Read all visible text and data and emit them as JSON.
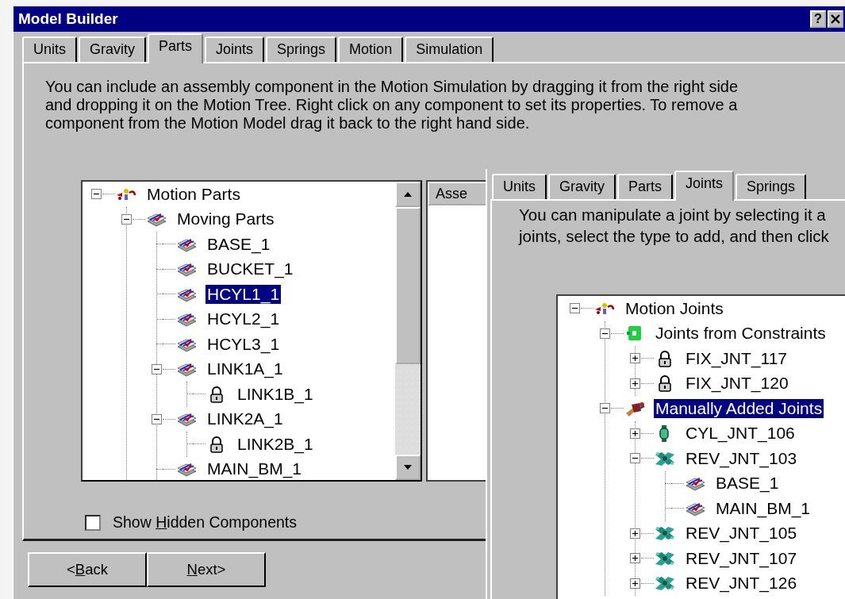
{
  "window": {
    "title": "Model Builder",
    "help_button": "?"
  },
  "tabs": [
    {
      "label": "Units",
      "selected": false
    },
    {
      "label": "Gravity",
      "selected": false
    },
    {
      "label": "Parts",
      "selected": true
    },
    {
      "label": "Joints",
      "selected": false
    },
    {
      "label": "Springs",
      "selected": false
    },
    {
      "label": "Motion",
      "selected": false
    },
    {
      "label": "Simulation",
      "selected": false
    }
  ],
  "description": "You can include an assembly component in the Motion Simulation by dragging it from the right side and dropping it on the Motion Tree. Right click on any component to set its properties. To remove a component from the Motion Model drag it back to the right hand side.",
  "parts_tree": [
    {
      "label": "Motion Parts",
      "kind": "motion",
      "expanded": true,
      "selected": false,
      "children": [
        {
          "label": "Moving Parts",
          "kind": "part",
          "expanded": true,
          "selected": false,
          "children": [
            {
              "label": "BASE_1",
              "kind": "part",
              "selected": false
            },
            {
              "label": "BUCKET_1",
              "kind": "part",
              "selected": false
            },
            {
              "label": "HCYL1_1",
              "kind": "part",
              "selected": true
            },
            {
              "label": "HCYL2_1",
              "kind": "part",
              "selected": false
            },
            {
              "label": "HCYL3_1",
              "kind": "part",
              "selected": false
            },
            {
              "label": "LINK1A_1",
              "kind": "part",
              "expanded": true,
              "selected": false,
              "children": [
                {
                  "label": "LINK1B_1",
                  "kind": "lock",
                  "selected": false
                }
              ]
            },
            {
              "label": "LINK2A_1",
              "kind": "part",
              "expanded": true,
              "selected": false,
              "children": [
                {
                  "label": "LINK2B_1",
                  "kind": "lock",
                  "selected": false
                }
              ]
            },
            {
              "label": "MAIN_BM_1",
              "kind": "part",
              "selected": false
            }
          ]
        }
      ]
    }
  ],
  "assembly_list": {
    "column_1": "Asse"
  },
  "show_hidden": {
    "label_parts": [
      {
        "text": "Show ",
        "underlined": false
      },
      {
        "text": "H",
        "underlined": true
      },
      {
        "text": "idden Components",
        "underlined": false
      }
    ],
    "checked": false
  },
  "buttons": [
    {
      "label_parts": [
        {
          "text": "<",
          "underlined": false
        },
        {
          "text": "B",
          "underlined": true
        },
        {
          "text": "ack",
          "underlined": false
        }
      ]
    },
    {
      "label_parts": [
        {
          "text": "N",
          "underlined": true
        },
        {
          "text": "ext>",
          "underlined": false
        }
      ]
    }
  ],
  "joints_window": {
    "tabs": [
      {
        "label": "Units",
        "selected": false
      },
      {
        "label": "Gravity",
        "selected": false
      },
      {
        "label": "Parts",
        "selected": false
      },
      {
        "label": "Joints",
        "selected": true
      },
      {
        "label": "Springs",
        "selected": false
      }
    ],
    "description_lines": [
      "You can manipulate a joint by selecting it a",
      "joints, select the type to add, and then click"
    ],
    "tree": [
      {
        "label": "Motion Joints",
        "kind": "motion",
        "expanded": true,
        "selected": false,
        "children": [
          {
            "label": "Joints from Constraints",
            "kind": "constraint",
            "expanded": true,
            "selected": false,
            "children": [
              {
                "label": "FIX_JNT_117",
                "kind": "lock",
                "expanded": false,
                "selected": false
              },
              {
                "label": "FIX_JNT_120",
                "kind": "lock",
                "expanded": false,
                "selected": false
              }
            ]
          },
          {
            "label": "Manually Added Joints",
            "kind": "manual",
            "expanded": true,
            "selected": true,
            "children": [
              {
                "label": "CYL_JNT_106",
                "kind": "cylinder",
                "expanded": false,
                "selected": false
              },
              {
                "label": "REV_JNT_103",
                "kind": "revolute",
                "expanded": true,
                "selected": false,
                "children": [
                  {
                    "label": "BASE_1",
                    "kind": "part",
                    "selected": false
                  },
                  {
                    "label": "MAIN_BM_1",
                    "kind": "part",
                    "selected": false
                  }
                ]
              },
              {
                "label": "REV_JNT_105",
                "kind": "revolute",
                "expanded": false,
                "selected": false
              },
              {
                "label": "REV_JNT_107",
                "kind": "revolute",
                "expanded": false,
                "selected": false
              },
              {
                "label": "REV_JNT_126",
                "kind": "revolute",
                "expanded": false,
                "selected": false
              }
            ]
          }
        ]
      }
    ]
  }
}
